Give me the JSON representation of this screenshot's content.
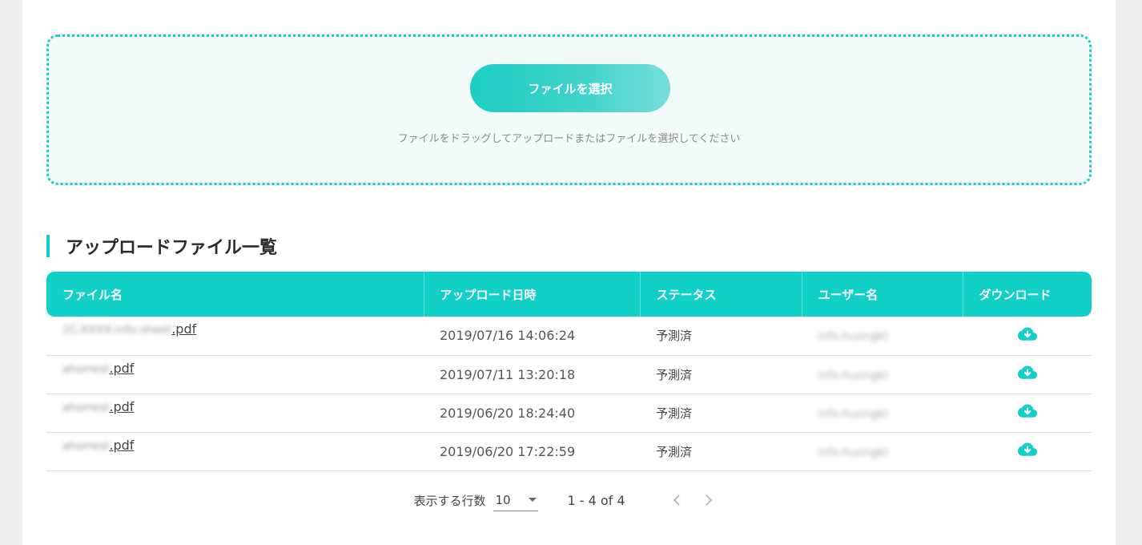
{
  "upload": {
    "button_label": "ファイルを選択",
    "hint": "ファイルをドラッグしてアップロードまたはファイルを選択してください"
  },
  "section": {
    "title": "アップロードファイル一覧"
  },
  "table": {
    "columns": [
      "ファイル名",
      "アップロード日時",
      "ステータス",
      "ユーザー名",
      "ダウンロード"
    ],
    "rows": [
      {
        "file_prefix": "2C-XXXX-info-sheet",
        "file_ext": ".pdf",
        "uploaded_at": "2019/07/16 14:06:24",
        "status": "予測済",
        "user": "info.huongkt"
      },
      {
        "file_prefix": "ahorrest",
        "file_ext": ".pdf",
        "uploaded_at": "2019/07/11 13:20:18",
        "status": "予測済",
        "user": "info.huongkt"
      },
      {
        "file_prefix": "ahorrest",
        "file_ext": ".pdf",
        "uploaded_at": "2019/06/20 18:24:40",
        "status": "予測済",
        "user": "info.huongkt"
      },
      {
        "file_prefix": "ahorrest",
        "file_ext": ".pdf",
        "uploaded_at": "2019/06/20 17:22:59",
        "status": "予測済",
        "user": "info.huongkt"
      }
    ]
  },
  "pagination": {
    "rows_label": "表示する行数",
    "rows_value": "10",
    "range": "1 - 4 of 4"
  },
  "colors": {
    "accent": "#10d0c8"
  },
  "icons": {
    "download": "cloud-download-icon",
    "prev": "chevron-left-icon",
    "next": "chevron-right-icon",
    "dropdown": "caret-down-icon"
  }
}
